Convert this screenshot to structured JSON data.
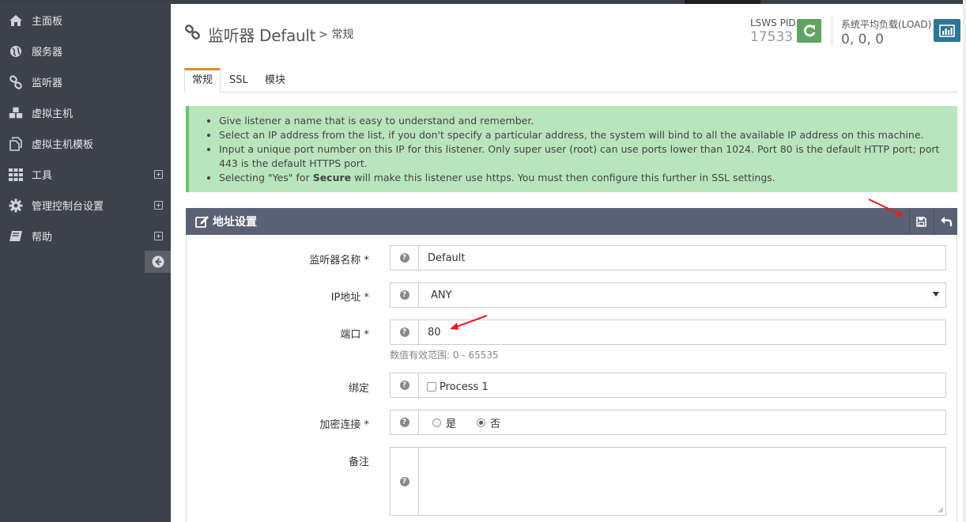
{
  "sidebar": {
    "items": [
      {
        "label": "主面板",
        "icon": "home-icon"
      },
      {
        "label": "服务器",
        "icon": "globe-icon"
      },
      {
        "label": "监听器",
        "icon": "link-icon"
      },
      {
        "label": "虚拟主机",
        "icon": "cubes-icon"
      },
      {
        "label": "虚拟主机模板",
        "icon": "copy-icon"
      },
      {
        "label": "工具",
        "icon": "grid-icon",
        "expandable": true
      },
      {
        "label": "管理控制台设置",
        "icon": "gear-icon",
        "expandable": true
      },
      {
        "label": "帮助",
        "icon": "book-icon",
        "expandable": true
      }
    ]
  },
  "header": {
    "title": "监听器 Default",
    "subtitle": "> 常规",
    "pid_label": "LSWS PID",
    "pid_value": "17533",
    "load_label": "系统平均负载(LOAD)",
    "load_value": "0, 0, 0"
  },
  "tabs": [
    {
      "label": "常规",
      "active": true
    },
    {
      "label": "SSL",
      "active": false
    },
    {
      "label": "模块",
      "active": false
    }
  ],
  "alert": {
    "items": [
      "Give listener a name that is easy to understand and remember.",
      "Select an IP address from the list, if you don't specify a particular address, the system will bind to all the available IP address on this machine.",
      "Input a unique port number on this IP for this listener. Only super user (root) can use ports lower than 1024. Port 80 is the default HTTP port; port 443 is the default HTTPS port."
    ],
    "last_prefix": "Selecting \"Yes\" for ",
    "last_bold": "Secure",
    "last_suffix": " will make this listener use https. You must then configure this further in SSL settings."
  },
  "panel": {
    "title": "地址设置",
    "fields": {
      "name_label": "监听器名称 *",
      "name_value": "Default",
      "ip_label": "IP地址 *",
      "ip_value": "ANY",
      "port_label": "端口 *",
      "port_value": "80",
      "port_hint": "数值有效范围: 0 - 65535",
      "bind_label": "绑定",
      "bind_option": "Process 1",
      "secure_label": "加密连接 *",
      "secure_yes": "是",
      "secure_no": "否",
      "secure_selected": "否",
      "notes_label": "备注",
      "notes_value": ""
    }
  },
  "colors": {
    "sidebar_bg": "#3d414b",
    "panel_header_bg": "#5a6175",
    "alert_bg": "#b9e5bd",
    "restart_btn": "#5fa462",
    "chart_btn": "#2d7694",
    "active_tab_accent": "#e58a2b",
    "annotation_arrow": "#e02020"
  }
}
